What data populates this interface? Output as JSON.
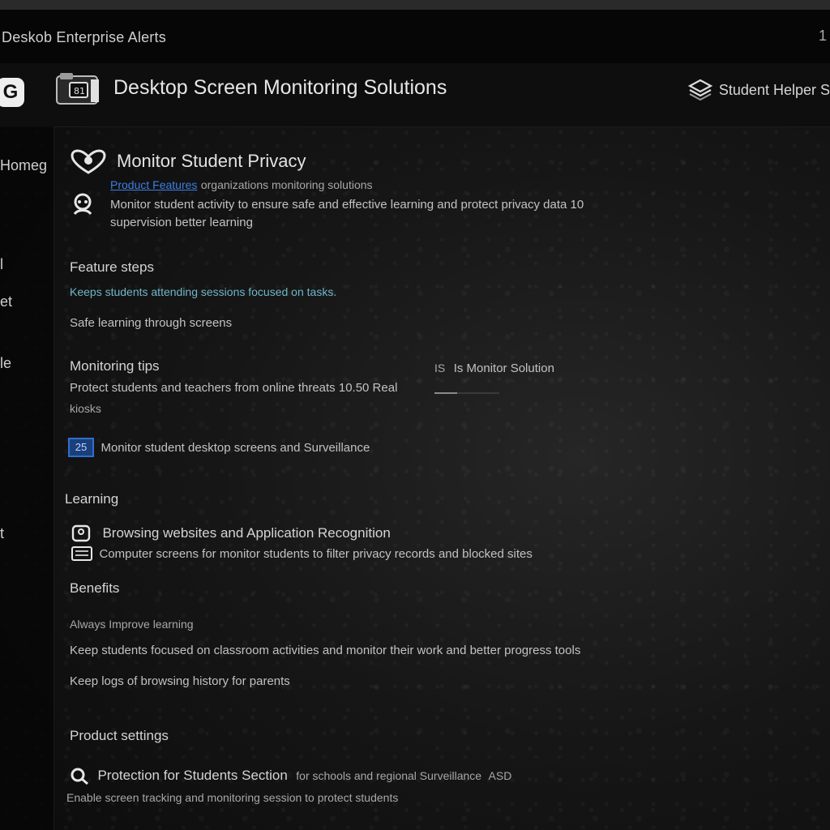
{
  "window": {
    "title": "Deskob Enterprise Alerts",
    "right_glyph": "1"
  },
  "header": {
    "logo_letter": "G",
    "app_title": "Desktop Screen Monitoring Solutions",
    "right_label": "Student Helper S"
  },
  "sidebar": {
    "items": [
      "Homeg",
      "l",
      "et",
      "le",
      "t"
    ]
  },
  "intro": {
    "title": "Monitor Student Privacy",
    "link": "Product Features",
    "link_suffix": "organizations monitoring solutions",
    "line1": "Monitor student activity to ensure safe and effective learning and protect privacy data 10",
    "line2": "supervision better learning"
  },
  "features": {
    "heading": "Feature steps",
    "line1": "Keeps students attending sessions focused on tasks.",
    "line2": "Safe learning through screens"
  },
  "monitoring": {
    "heading": "Monitoring tips",
    "line1": "Protect students and teachers from online threats 10.50 Real",
    "line2": "kiosks",
    "right_label": "Is Monitor Solution",
    "right_prefix": "IS",
    "progress": 0.35
  },
  "option": {
    "check_label": "25",
    "text": "Monitor student desktop screens and Surveillance"
  },
  "learn": {
    "heading": "Learning",
    "item_title": "Browsing websites and Application Recognition",
    "item_text": "Computer screens for monitor students to filter privacy records and blocked sites"
  },
  "benefits": {
    "heading": "Benefits",
    "sub": "Always Improve learning",
    "line1": "Keep students focused on classroom activities and monitor their work and better progress tools",
    "line2": "Keep logs of browsing history for parents"
  },
  "product": {
    "heading": "Product settings",
    "item_title": "Protection for Students Section",
    "item_suffix": "for schools and regional Surveillance",
    "item_tail": "ASD",
    "line": "Enable screen tracking and monitoring session to protect students"
  },
  "colors": {
    "accent": "#3d7fe6",
    "background": "#0b0b0b"
  }
}
